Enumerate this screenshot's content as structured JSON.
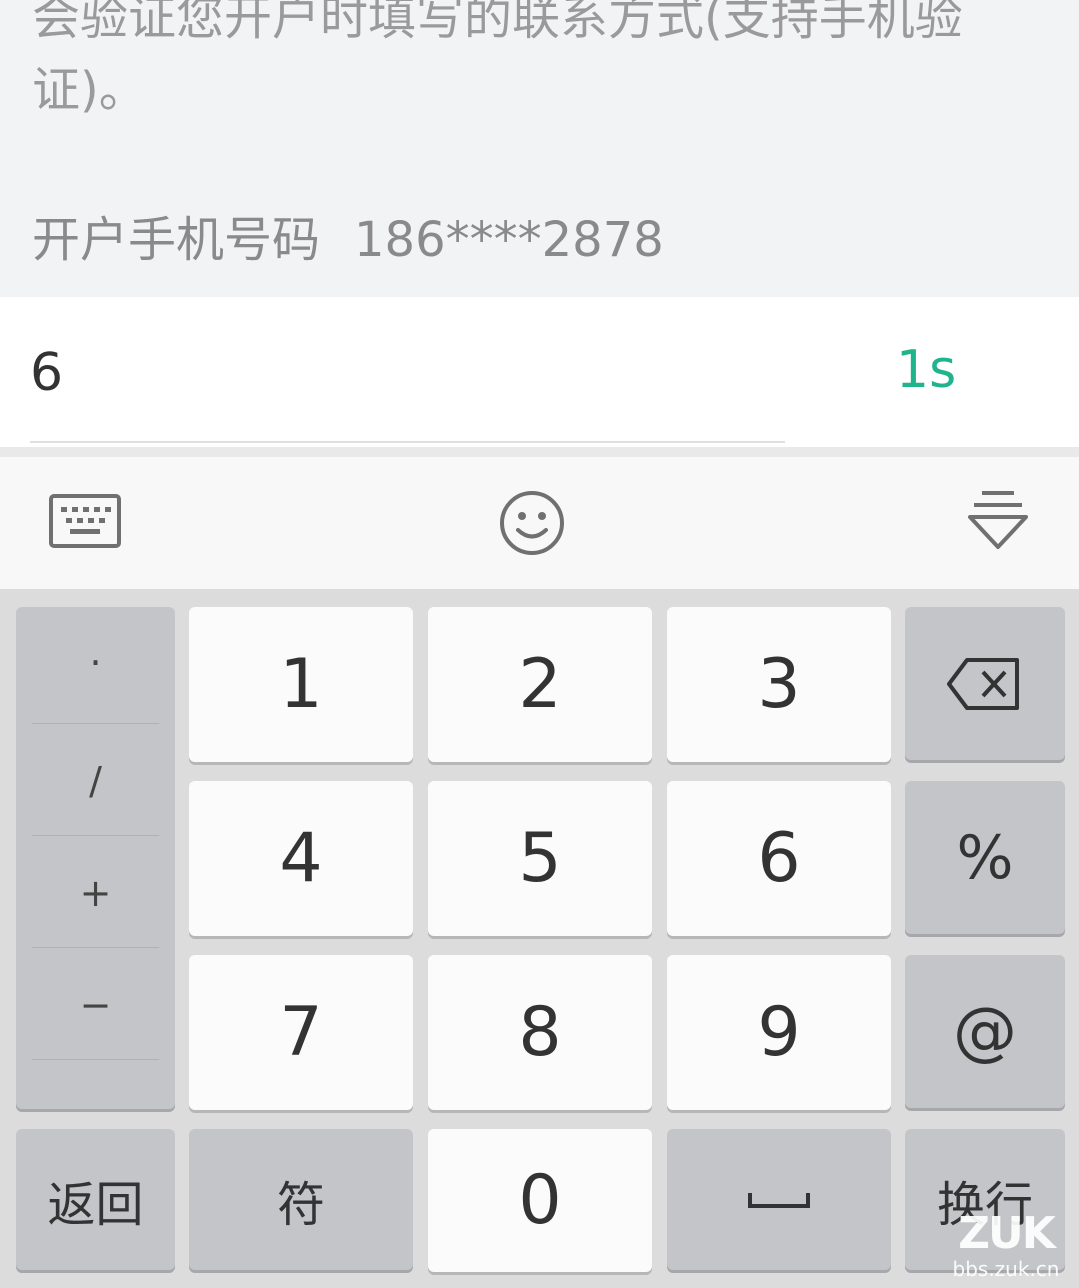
{
  "info": {
    "description": "会验证您开户时填写的联系方式(支持手机验证)。",
    "phone_label": "开户手机号码",
    "phone_value": "186****2878"
  },
  "code": {
    "value": "6",
    "countdown": "1s"
  },
  "toolbar": {
    "icons": [
      "keyboard-icon",
      "emoji-icon",
      "collapse-keyboard-icon"
    ]
  },
  "keyboard": {
    "symbols": [
      "·",
      "/",
      "+",
      "−"
    ],
    "digits": {
      "k1": "1",
      "k2": "2",
      "k3": "3",
      "k4": "4",
      "k5": "5",
      "k6": "6",
      "k7": "7",
      "k8": "8",
      "k9": "9",
      "k0": "0"
    },
    "side": {
      "percent": "%",
      "at": "@"
    },
    "bottom": {
      "back": "返回",
      "symbol": "符",
      "enter": "换行"
    },
    "icons": {
      "backspace": "backspace-icon",
      "space": "space-bar-icon"
    }
  },
  "watermark": {
    "logo": "ZUK",
    "url": "bbs.zuk.cn"
  }
}
